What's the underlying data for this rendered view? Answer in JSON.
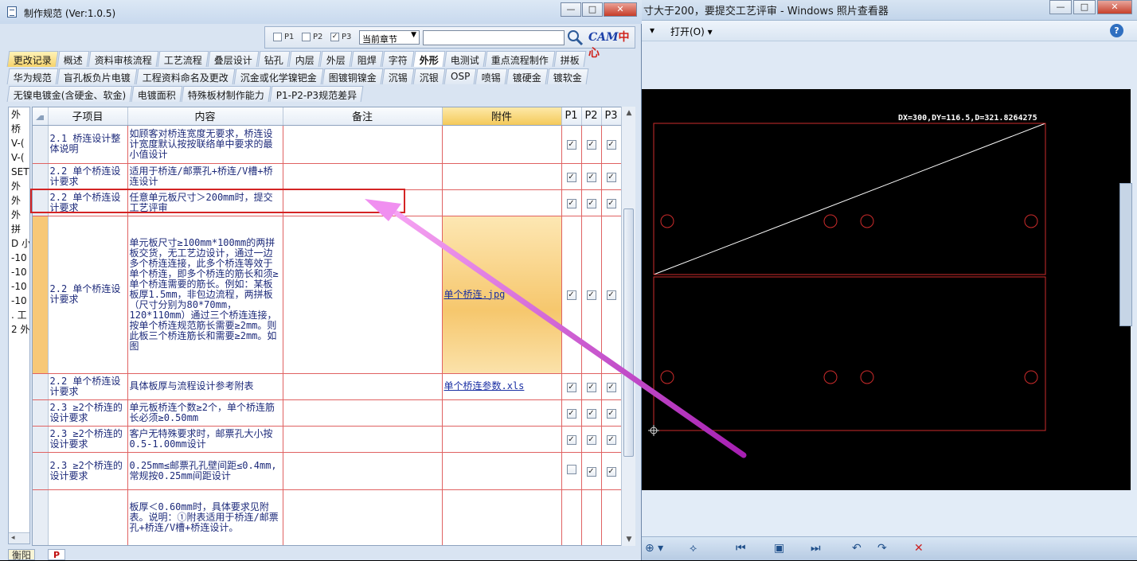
{
  "viewer": {
    "title": "寸大于200，要提交工艺评审 - Windows 照片查看器",
    "win_buttons": [
      "—",
      "□",
      "✕"
    ],
    "menu_back": "▾",
    "menu_open": "打开(O)  ▾",
    "help": "?",
    "cad_readout": "DX=300,DY=116.5,D=321.8264275",
    "toolbar_glyphs": [
      "⊕ ▾",
      "⟡",
      "⏮",
      "▣",
      "⏭",
      "↶",
      "↷",
      "✕"
    ]
  },
  "dialog": {
    "title": "制作规范 (Ver:1.0.5)",
    "win_buttons": [
      "—",
      "□",
      "✕"
    ]
  },
  "search": {
    "p1_label": "P1",
    "p2_label": "P2",
    "p3_label": "P3",
    "p1_checked": false,
    "p2_checked": false,
    "p3_checked": true,
    "scope": "当前章节",
    "query": "",
    "logo_left": "CAM",
    "logo_right": "中心"
  },
  "tabs": {
    "row1": [
      "更改记录",
      "概述",
      "资料审核流程",
      "工艺流程",
      "叠层设计",
      "钻孔",
      "内层",
      "外层",
      "阻焊",
      "字符",
      "外形",
      "电测试",
      "重点流程制作",
      "拼板"
    ],
    "row2": [
      "华为规范",
      "盲孔板负片电镀",
      "工程资料命名及更改",
      "沉金或化学镍钯金",
      "图镀铜镍金",
      "沉锡",
      "沉银",
      "OSP",
      "喷锡",
      "镀硬金",
      "镀软金"
    ],
    "row3": [
      "无镍电镀金(含硬金、软金)",
      "电镀面积",
      "特殊板材制作能力",
      "P1-P2-P3规范差异"
    ],
    "active": "外形"
  },
  "sidebar": [
    "外",
    "桥",
    "V-(",
    "V-(",
    "SET",
    "外",
    "外",
    "外",
    "拼",
    "D 小",
    "-10",
    "-10",
    "-10",
    "-10",
    ". 工",
    "2 外"
  ],
  "grid": {
    "headers": [
      "子项目",
      "内容",
      "备注",
      "附件",
      "P1",
      "P2",
      "P3"
    ],
    "rows": [
      {
        "sub": "2.1 桥连设计整体说明",
        "content": "如顾客对桥连宽度无要求，桥连设计宽度默认按按联络单中要求的最小值设计",
        "note": "",
        "att": "",
        "p": [
          true,
          true,
          true
        ]
      },
      {
        "sub": "2.2 单个桥连设计要求",
        "content": "适用于桥连/邮票孔+桥连/V槽+桥连设计",
        "note": "",
        "att": "",
        "p": [
          true,
          true,
          true
        ]
      },
      {
        "sub": "2.2 单个桥连设计要求",
        "content": "任意单元板尺寸＞200mm时，提交工艺评审",
        "note": "",
        "att": "",
        "p": [
          true,
          true,
          true
        ]
      },
      {
        "sub": "2.2 单个桥连设计要求",
        "content": "单元板尺寸≥100mm*100mm的两拼板交货，无工艺边设计，通过一边多个桥连连接，此多个桥连等效于单个桥连，即多个桥连的筋长和须≥单个桥连需要的筋长。例如：某板板厚1.5mm，非包边流程，两拼板（尺寸分别为80*70mm，120*110mm）通过三个桥连连接，按单个桥连规范筋长需要≥2mm。则此板三个桥连筋长和需要≥2mm。如图",
        "note": "",
        "att": "单个桥连.jpg",
        "p": [
          true,
          true,
          true
        ]
      },
      {
        "sub": "2.2 单个桥连设计要求",
        "content": "具体板厚与流程设计参考附表",
        "note": "",
        "att": "单个桥连参数.xls",
        "p": [
          true,
          true,
          true
        ]
      },
      {
        "sub": "2.3 ≥2个桥连的设计要求",
        "content": "单元板桥连个数≥2个，单个桥连筋长必须≥0.50mm",
        "note": "",
        "att": "",
        "p": [
          true,
          true,
          true
        ]
      },
      {
        "sub": "2.3 ≥2个桥连的设计要求",
        "content": "客户无特殊要求时，邮票孔大小按0.5-1.00mm设计",
        "note": "",
        "att": "",
        "p": [
          true,
          true,
          true
        ]
      },
      {
        "sub": "2.3 ≥2个桥连的设计要求",
        "content": "0.25mm≤邮票孔孔壁间距≤0.4mm,常规按0.25mm间距设计",
        "note": "",
        "att": "",
        "p": [
          false,
          true,
          true
        ]
      },
      {
        "sub": "",
        "content": "板厚＜0.60mm时，具体要求见附表。说明：①附表适用于桥连/邮票孔+桥连/V槽+桥连设计。",
        "note": "",
        "att": "",
        "p": [
          null,
          null,
          null
        ]
      }
    ]
  },
  "scroll": {
    "up": "▲",
    "down": "▼",
    "left": "◂",
    "right": "▸"
  },
  "status": {
    "category": "衡阳",
    "tag": "P"
  },
  "colors": {
    "highlight": "#d42424",
    "arrow": "#e86ee8",
    "cad_outline": "#cc2b2b",
    "attachment_header": "#f4c95a"
  }
}
